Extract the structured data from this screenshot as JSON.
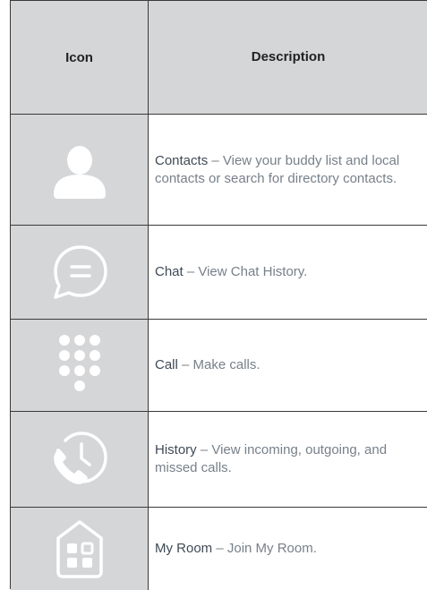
{
  "table": {
    "header": {
      "icon_col": "Icon",
      "desc_col": "Description"
    },
    "rows": [
      {
        "icon": "contacts-person-icon",
        "term": "Contacts",
        "text": " – View your buddy list and local contacts or search for directory contacts."
      },
      {
        "icon": "chat-bubble-icon",
        "term": "Chat",
        "text": " – View Chat History."
      },
      {
        "icon": "dialpad-icon",
        "term": "Call",
        "text": " – Make calls."
      },
      {
        "icon": "history-clock-phone-icon",
        "term": "History",
        "text": " – View incoming, outgoing, and missed calls."
      },
      {
        "icon": "my-room-house-icon",
        "term": "My Room",
        "text": " – Join My Room."
      }
    ]
  },
  "colors": {
    "icon_cell_bg": "#d5d6d8",
    "icon_fill": "#ffffff",
    "term_text": "#3f4a56",
    "body_text": "#77808a",
    "border": "#3a3a3a"
  }
}
